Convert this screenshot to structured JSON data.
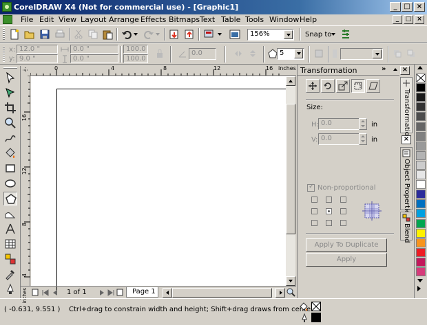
{
  "window": {
    "title": "CorelDRAW X4 (Not for commercial use) - [Graphic1]",
    "buttons": [
      "_",
      "□",
      "×"
    ]
  },
  "menu": {
    "items": [
      "File",
      "Edit",
      "View",
      "Layout",
      "Arrange",
      "Effects",
      "Bitmaps",
      "Text",
      "Table",
      "Tools",
      "Window",
      "Help"
    ],
    "mdi_buttons": [
      "_",
      "□",
      "×"
    ]
  },
  "standard_toolbar": {
    "zoom": "156%",
    "snap_to": "Snap to"
  },
  "property_bar": {
    "x_label": "x:",
    "x_value": "12.0 \"",
    "y_label": "y:",
    "y_value": "9.0 \"",
    "w_value": "0.0 \"",
    "h_value": "0.0 \"",
    "scale_w": "100.0",
    "scale_h": "100.0",
    "angle": "0.0",
    "polygon_points": "5"
  },
  "rulers": {
    "h_labels": [
      "0",
      "4",
      "8",
      "12",
      "16"
    ],
    "h_unit": "inches",
    "v_labels": [
      "16",
      "12",
      "8",
      "4"
    ],
    "v_unit": "inches"
  },
  "page_nav": {
    "count": "1 of 1",
    "page_tab": "Page 1"
  },
  "docker": {
    "title": "Transformation",
    "size_label": "Size:",
    "h_label": "H:",
    "h_value": "0.0",
    "h_unit": "in",
    "v_label": "V:",
    "v_value": "0.0",
    "v_unit": "in",
    "nonprop_label": "Non-proportional",
    "apply_dup": "Apply To Duplicate",
    "apply": "Apply"
  },
  "side_tabs": [
    "Transformation",
    "Object Properties",
    "Blend"
  ],
  "palette": {
    "colors": [
      "#ffffff",
      "#000000",
      "#1a1a1a",
      "#333333",
      "#4d4d4d",
      "#666666",
      "#808080",
      "#999999",
      "#b3b3b3",
      "#cccccc",
      "#e6e6e6",
      "#ffffff",
      "#2b2b9b",
      "#0070c0",
      "#00a0e0",
      "#00a651",
      "#fff200",
      "#f7941d",
      "#ed1c24",
      "#c2185b",
      "#d63b7a"
    ]
  },
  "status": {
    "coords": "( -0.631, 9.551 )",
    "hint": "Ctrl+drag to constrain width and height; Shift+drag draws from center"
  }
}
